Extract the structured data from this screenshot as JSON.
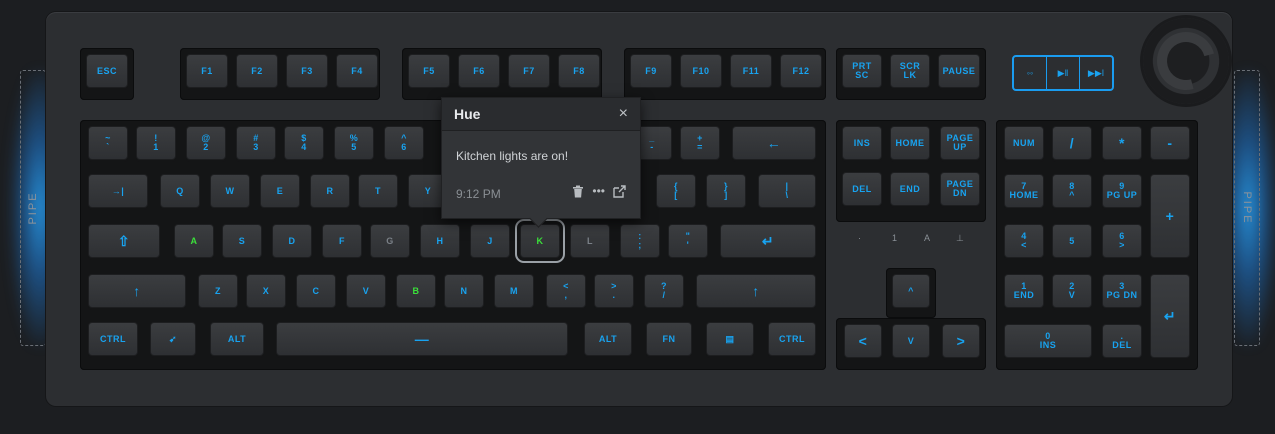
{
  "pipe_left": {
    "label": "PIPE"
  },
  "pipe_right": {
    "label": "PIPE"
  },
  "keyboard": {
    "function_row": [
      "ESC",
      "F1",
      "F2",
      "F3",
      "F4",
      "F5",
      "F6",
      "F7",
      "F8",
      "F9",
      "F10",
      "F11",
      "F12",
      "PRT\nSC",
      "SCR\nLK",
      "PAUSE"
    ],
    "media": [
      "prev-icon",
      "play-pause-icon",
      "next-icon"
    ],
    "number_row": [
      "~\n`",
      "!\n1",
      "@\n2",
      "#\n3",
      "$\n4",
      "%\n5",
      "^\n6",
      "_\n-",
      "+\n=",
      "←"
    ],
    "nav_top": [
      "INS",
      "HOME",
      "PAGE\nUP",
      "DEL",
      "END",
      "PAGE\nDN"
    ],
    "numpad": [
      "NUM",
      "/",
      "*",
      "-",
      "7\nHOME",
      "8\n^",
      "9\nPG UP",
      "+",
      "4\n<",
      "5",
      "6\n>",
      "1\nEND",
      "2\nV",
      "3\nPG DN",
      "↵",
      "0\nINS",
      ".\nDEL"
    ],
    "row_q": [
      "→|",
      "Q",
      "W",
      "E",
      "R",
      "T",
      "Y",
      "{\n[",
      "}\n]",
      "|\n\\"
    ],
    "row_a": [
      "⇧",
      "A",
      "S",
      "D",
      "F",
      "G",
      "H",
      "J",
      "K",
      "L",
      ":\n;",
      "\"\n'",
      "↵"
    ],
    "row_z": [
      "↑",
      "Z",
      "X",
      "C",
      "V",
      "B",
      "N",
      "M",
      "<\n,",
      ">\n.",
      "?\n/",
      "↑"
    ],
    "row_bottom": [
      "CTRL",
      "ALT",
      "—",
      "ALT",
      "FN",
      "CTRL"
    ],
    "arrows": [
      "^",
      "<",
      "V",
      ">"
    ],
    "indicators": [
      "·",
      "1",
      "A",
      "⊥"
    ]
  },
  "popup": {
    "title": "Hue",
    "close": "×",
    "message": "Kitchen lights are on!",
    "time": "9:12 PM"
  },
  "colors": {
    "accent": "#18a3f0",
    "highlight": "#3be03a"
  }
}
